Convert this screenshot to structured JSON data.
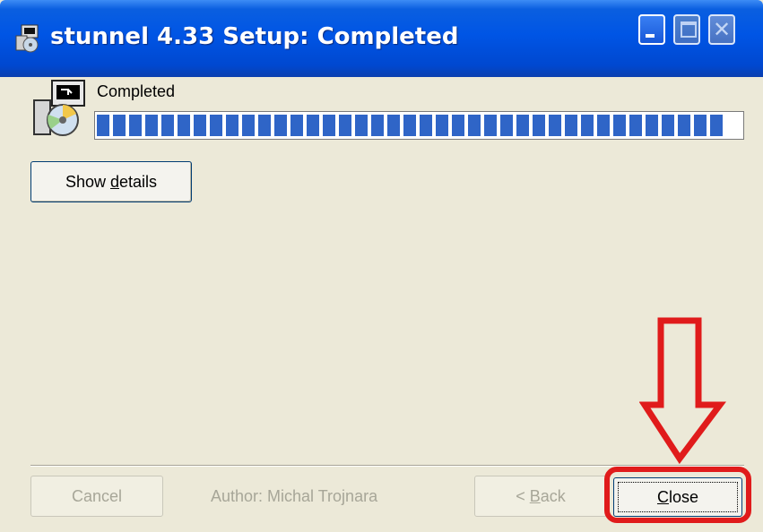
{
  "window": {
    "title": "stunnel 4.33 Setup: Completed",
    "colors": {
      "titlebar": "#0055e5",
      "face": "#ece9d8",
      "progress": "#2f65c7",
      "annotation": "#e01b1b"
    }
  },
  "status": {
    "label": "Completed",
    "progress_percent": 100
  },
  "buttons": {
    "show_details": {
      "pre": "Show ",
      "key": "d",
      "post": "etails"
    },
    "cancel": {
      "label": "Cancel"
    },
    "back": {
      "pre": "< ",
      "key": "B",
      "post": "ack"
    },
    "close": {
      "key": "C",
      "post": "lose"
    }
  },
  "footer": {
    "author": "Author: Michal Trojnara"
  },
  "icons": [
    "setup-app-icon",
    "minimize-icon",
    "maximize-icon",
    "close-icon",
    "installer-icon",
    "red-down-arrow"
  ]
}
